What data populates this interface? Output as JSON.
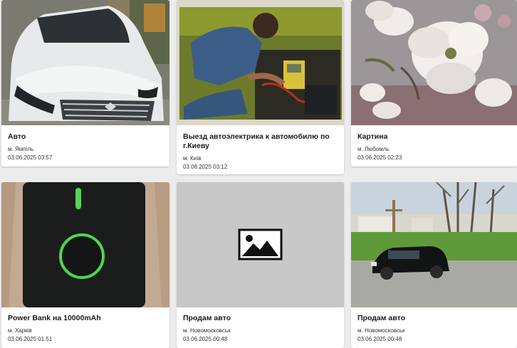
{
  "listings": [
    {
      "title": "Авто",
      "city": "м. Ямпіль",
      "date": "03.06.2025 03:57",
      "image": "white-car-photo"
    },
    {
      "title": "Выезд автоэлектрика к автомобилю по г.Киеву",
      "city": "м. Київ",
      "date": "03.06.2025 03:12",
      "image": "auto-electrician-photo"
    },
    {
      "title": "Картина",
      "city": "м. Любомль",
      "date": "03.06.2025 02:23",
      "image": "flower-painting-photo"
    },
    {
      "title": "Power Bank на 10000mAh",
      "city": "м. Харків",
      "date": "03.06.2025 01:51",
      "image": "power-bank-photo"
    },
    {
      "title": "Продам авто",
      "city": "м. Новомосковськ",
      "date": "03.06.2025 00:48",
      "image": "image-placeholder-icon"
    },
    {
      "title": "Продам авто",
      "city": "м. Новомосковськ",
      "date": "03.06.2025 00:48",
      "image": "black-suv-photo"
    }
  ]
}
